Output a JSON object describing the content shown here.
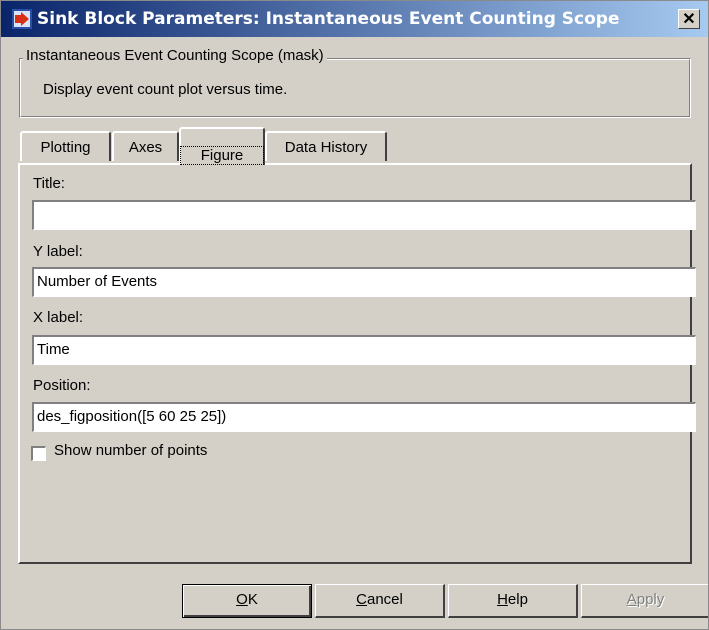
{
  "window": {
    "title": "Sink Block Parameters: Instantaneous Event Counting Scope",
    "close_label": "✕"
  },
  "mask": {
    "group_title": "Instantaneous Event Counting Scope (mask)",
    "description": "Display event count plot versus time."
  },
  "tabs": [
    {
      "label": "Plotting",
      "active": false
    },
    {
      "label": "Axes",
      "active": false
    },
    {
      "label": "Figure",
      "active": true
    },
    {
      "label": "Data History",
      "active": false
    }
  ],
  "fields": {
    "title_label": "Title:",
    "title_value": "",
    "ylabel_label": "Y label:",
    "ylabel_value": "Number of Events",
    "xlabel_label": "X label:",
    "xlabel_value": "Time",
    "position_label": "Position:",
    "position_value": "des_figposition([5 60 25 25])"
  },
  "checkbox": {
    "label": "Show number of points",
    "checked": false
  },
  "buttons": {
    "ok": {
      "mnemonic": "O",
      "rest": "K"
    },
    "cancel": {
      "mnemonic": "C",
      "rest": "ancel"
    },
    "help": {
      "mnemonic": "H",
      "rest": "elp"
    },
    "apply": {
      "mnemonic": "A",
      "rest": "pply",
      "enabled": false
    }
  },
  "colors": {
    "titlebar_start": "#0a246a",
    "titlebar_end": "#a6caf0",
    "face": "#d4d0c8"
  }
}
